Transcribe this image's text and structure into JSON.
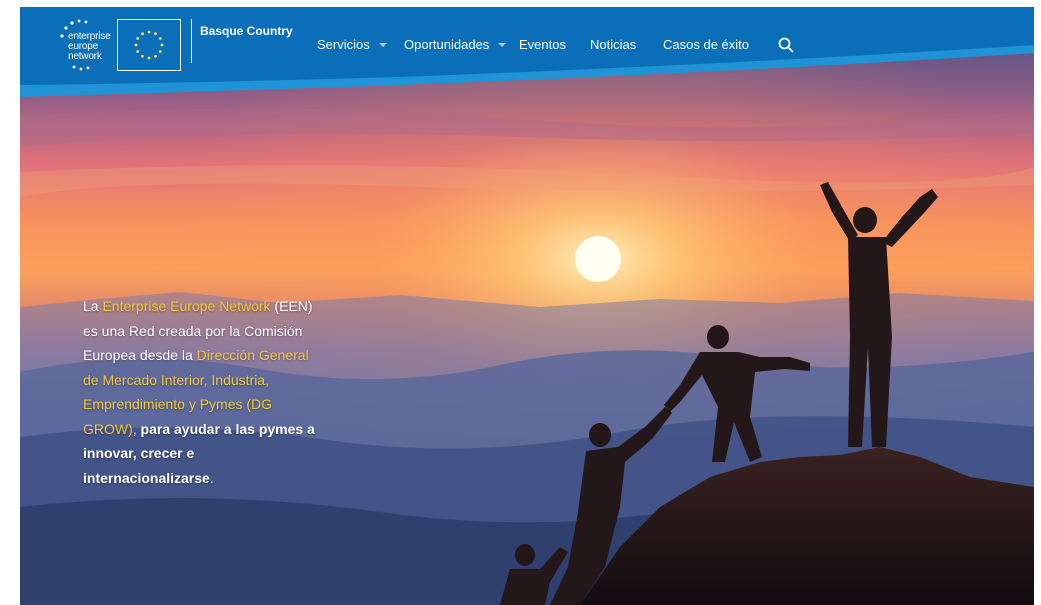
{
  "brand": {
    "een_logo_lines": [
      "enterprise",
      "europe",
      "network"
    ],
    "region": "Basque Country",
    "colors": {
      "primary": "#0a6fb8",
      "accent": "#1f93d6",
      "highlight": "#f5c842"
    }
  },
  "nav": {
    "items": [
      {
        "label": "Servicios",
        "has_dropdown": true
      },
      {
        "label": "Oportunidades",
        "has_dropdown": true
      },
      {
        "label": "Eventos",
        "has_dropdown": false
      },
      {
        "label": "Noticias",
        "has_dropdown": false
      },
      {
        "label": "Casos de éxito",
        "has_dropdown": false
      }
    ],
    "search_icon": "search-icon"
  },
  "hero": {
    "parts": [
      "La ",
      "Enterprise Europe Network",
      " (EEN) es una Red creada por la Comisión Europea desde la ",
      "Dirección General de Mercado Interior, Industria, Emprendimiento y Pymes (DG GROW)",
      ", ",
      "para ayudar a las pymes a innovar, crecer e internacionalizarse",
      "."
    ]
  }
}
